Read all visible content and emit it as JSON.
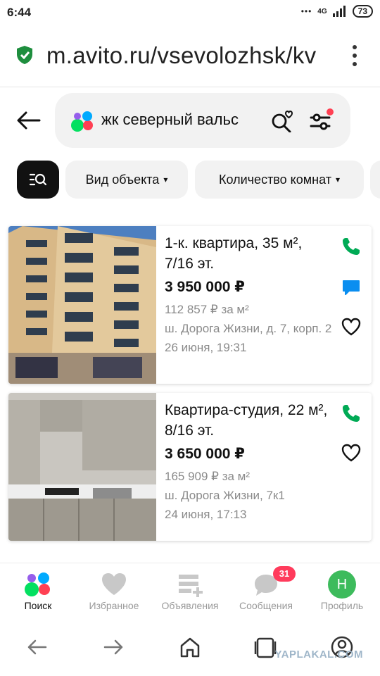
{
  "status_bar": {
    "time": "6:44",
    "network": "4G",
    "battery": "73"
  },
  "browser": {
    "url": "m.avito.ru/vsevolozhsk/kv"
  },
  "search": {
    "query": "жк северный вальс"
  },
  "filters": {
    "chips": [
      {
        "label": "Вид объекта"
      },
      {
        "label": "Количество комнат"
      }
    ]
  },
  "listings": [
    {
      "title": "1-к. квартира, 35 м², 7/16 эт.",
      "price": "3 950 000 ₽",
      "price_per_sqm": "112 857 ₽ за м²",
      "address": "ш. Дорога Жизни, д. 7, корп. 2",
      "date": "26 июня, 19:31"
    },
    {
      "title": "Квартира-студия, 22 м², 8/16 эт.",
      "price": "3 650 000 ₽",
      "price_per_sqm": "165 909 ₽ за м²",
      "address": "ш. Дорога Жизни, 7к1",
      "date": "24 июня, 17:13"
    }
  ],
  "bottom_nav": {
    "items": [
      {
        "label": "Поиск"
      },
      {
        "label": "Избранное"
      },
      {
        "label": "Объявления"
      },
      {
        "label": "Сообщения",
        "badge": "31"
      },
      {
        "label": "Профиль",
        "avatar_letter": "Н"
      }
    ]
  },
  "watermark": "YAPLAKAL.COM",
  "colors": {
    "brand_green": "#00aa55",
    "chat_blue": "#0a8ef0",
    "badge_red": "#ff3b5c",
    "avatar_green": "#3dbb5c"
  }
}
